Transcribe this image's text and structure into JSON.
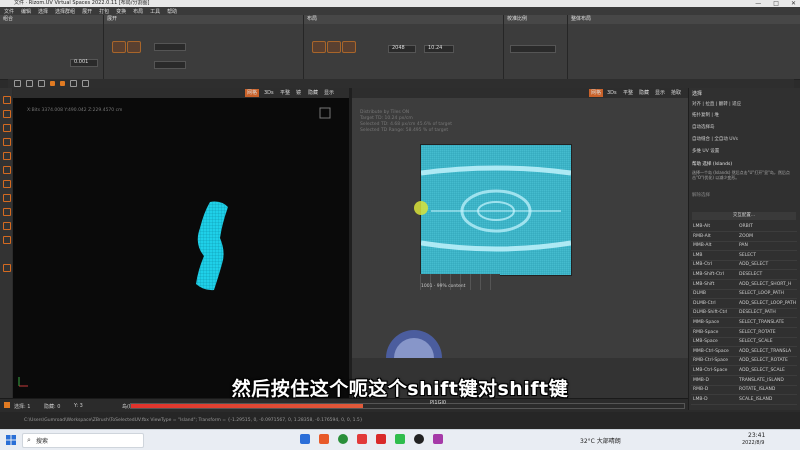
{
  "window": {
    "title": "文件 · Rizom.UV Virtual Spaces 2022.0.11 [布局/分割图]",
    "controls": [
      "—",
      "□",
      "✕"
    ]
  },
  "menubar": [
    "文件",
    "编辑",
    "选择",
    "选择群组",
    "展开",
    "打包",
    "变换",
    "布局",
    "工具",
    "帮助"
  ],
  "ribbon": {
    "panels": [
      "组合",
      "展开",
      "布局",
      "校准比例",
      "整体布局"
    ],
    "values": {
      "a": "0.001",
      "b": "10.24",
      "c": "2048"
    }
  },
  "view3d": {
    "tabs": [
      "网格",
      "3Ds",
      "平整",
      "镜",
      "隐藏",
      "显示"
    ],
    "info": "X:Bits 3374.008  Y:490.042  Z:229.4570 cm"
  },
  "viewuv": {
    "tabs": [
      "网格",
      "3Ds",
      "平整",
      "隐藏",
      "显示",
      "拾取"
    ],
    "info_lines": [
      "Distribute by Tiles ON",
      "Target TD: 10.24 px/cm",
      "Selected TD: 4.68 px/cm  45.6% of target",
      "Selected TD Range: 58.495 % of target"
    ],
    "tile_label": "1001 · 99% content"
  },
  "right_panel": {
    "title": "选择",
    "links": [
      "对齐 | 拉直 | 翻转 | 适应",
      "拓扑复制 | 堆",
      "自动选择岛",
      "自动缝合 | 全自动 UVs",
      "多维 UV 设置",
      "帮助 选择 (Islands)"
    ],
    "help_text": "选择一个岛 (Islands) 然后点击\"U\"打开\"显\"岛，然后点击\"O\"(优化)  以减少变形。",
    "more": "解除选择",
    "shortcuts_title": "交互配置...",
    "shortcuts": [
      [
        "LMB-Alt",
        "ORBIT"
      ],
      [
        "RMB-Alt",
        "ZOOM"
      ],
      [
        "MMB-Alt",
        "PAN"
      ],
      [
        "LMB",
        "SELECT"
      ],
      [
        "LMB-Ctrl",
        "ADD_SELECT"
      ],
      [
        "LMB-Shift-Ctrl",
        "DESELECT"
      ],
      [
        "LMB-Shift",
        "ADD_SELECT_SHORT_H"
      ],
      [
        "DLMB",
        "SELECT_LOOP_PATH"
      ],
      [
        "DLMB-Ctrl",
        "ADD_SELECT_LOOP_PATH"
      ],
      [
        "DLMB-Shift-Ctrl",
        "DESELECT_PATH"
      ],
      [
        "MMB-Space",
        "SELECT_TRANSLATE"
      ],
      [
        "RMB-Space",
        "SELECT_ROTATE"
      ],
      [
        "LMB-Space",
        "SELECT_SCALE"
      ],
      [
        "MMB-Ctrl-Space",
        "ADD_SELECT_TRANSLA"
      ],
      [
        "RMB-Ctrl-Space",
        "ADD_SELECT_ROTATE"
      ],
      [
        "LMB-Ctrl-Space",
        "ADD_SELECT_SCALE"
      ],
      [
        "MMB-D",
        "TRANSLATE_ISLAND"
      ],
      [
        "RMB-D",
        "ROTATE_ISLAND"
      ],
      [
        "LMB-D",
        "SCALE_ISLAND"
      ]
    ]
  },
  "bottom": {
    "tab1": "选择: 1",
    "tab2": "隐藏: 0",
    "tab3": "Y: 3",
    "tab4": "岛(D)",
    "progress": 0.42,
    "time": "Pl1Gl0"
  },
  "console": "C:\\Users\\Gumroad\\Workspace\\ZBrush\\ToSelectedUV.fbx  ViewType = \"Island\"; Transform = {-1.29515, 0, -0.0971567, 0, 1.28358, -0.176594, 0, 0, 1.5}",
  "subtitle": "然后按住这个呃这个shift键对shift键",
  "taskbar": {
    "search": "搜索",
    "weather": "32°C 大部晴朗",
    "time": "23:41",
    "date": "2022/8/9"
  },
  "colors": {
    "accent": "#e07a22",
    "uv_fill": "#29c2d8",
    "mesh": "#1fd0e8"
  }
}
